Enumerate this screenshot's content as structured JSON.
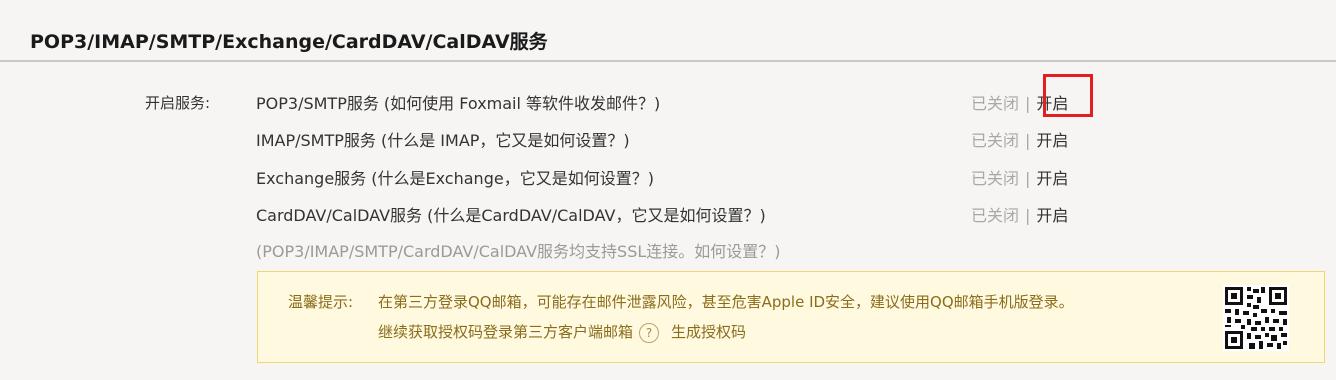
{
  "section": {
    "title": "POP3/IMAP/SMTP/Exchange/CardDAV/CalDAV服务"
  },
  "services": {
    "row_label": "开启服务:",
    "items": [
      {
        "name": "POP3/SMTP服务 (如何使用 Foxmail 等软件收发邮件？)",
        "status_closed": "已关闭",
        "separator": "|",
        "action_open": "开启"
      },
      {
        "name": "IMAP/SMTP服务 (什么是 IMAP，它又是如何设置？)",
        "status_closed": "已关闭",
        "separator": "|",
        "action_open": "开启"
      },
      {
        "name": "Exchange服务 (什么是Exchange，它又是如何设置？)",
        "status_closed": "已关闭",
        "separator": "|",
        "action_open": "开启"
      },
      {
        "name": "CardDAV/CalDAV服务 (什么是CardDAV/CalDAV，它又是如何设置？)",
        "status_closed": "已关闭",
        "separator": "|",
        "action_open": "开启"
      }
    ],
    "ssl_note": "(POP3/IMAP/SMTP/CardDAV/CalDAV服务均支持SSL连接。如何设置？)"
  },
  "tip": {
    "label": "温馨提示:",
    "line1": "在第三方登录QQ邮箱，可能存在邮件泄露风险，甚至危害Apple ID安全，建议使用QQ邮箱手机版登录。",
    "line2": "继续获取授权码登录第三方客户端邮箱",
    "help_icon_glyph": "?",
    "generate_link": "生成授权码"
  },
  "colors": {
    "highlight": "#e02020",
    "tip_background": "#fff9df",
    "tip_border": "#f0d770",
    "tip_text": "#8a6d1b"
  }
}
